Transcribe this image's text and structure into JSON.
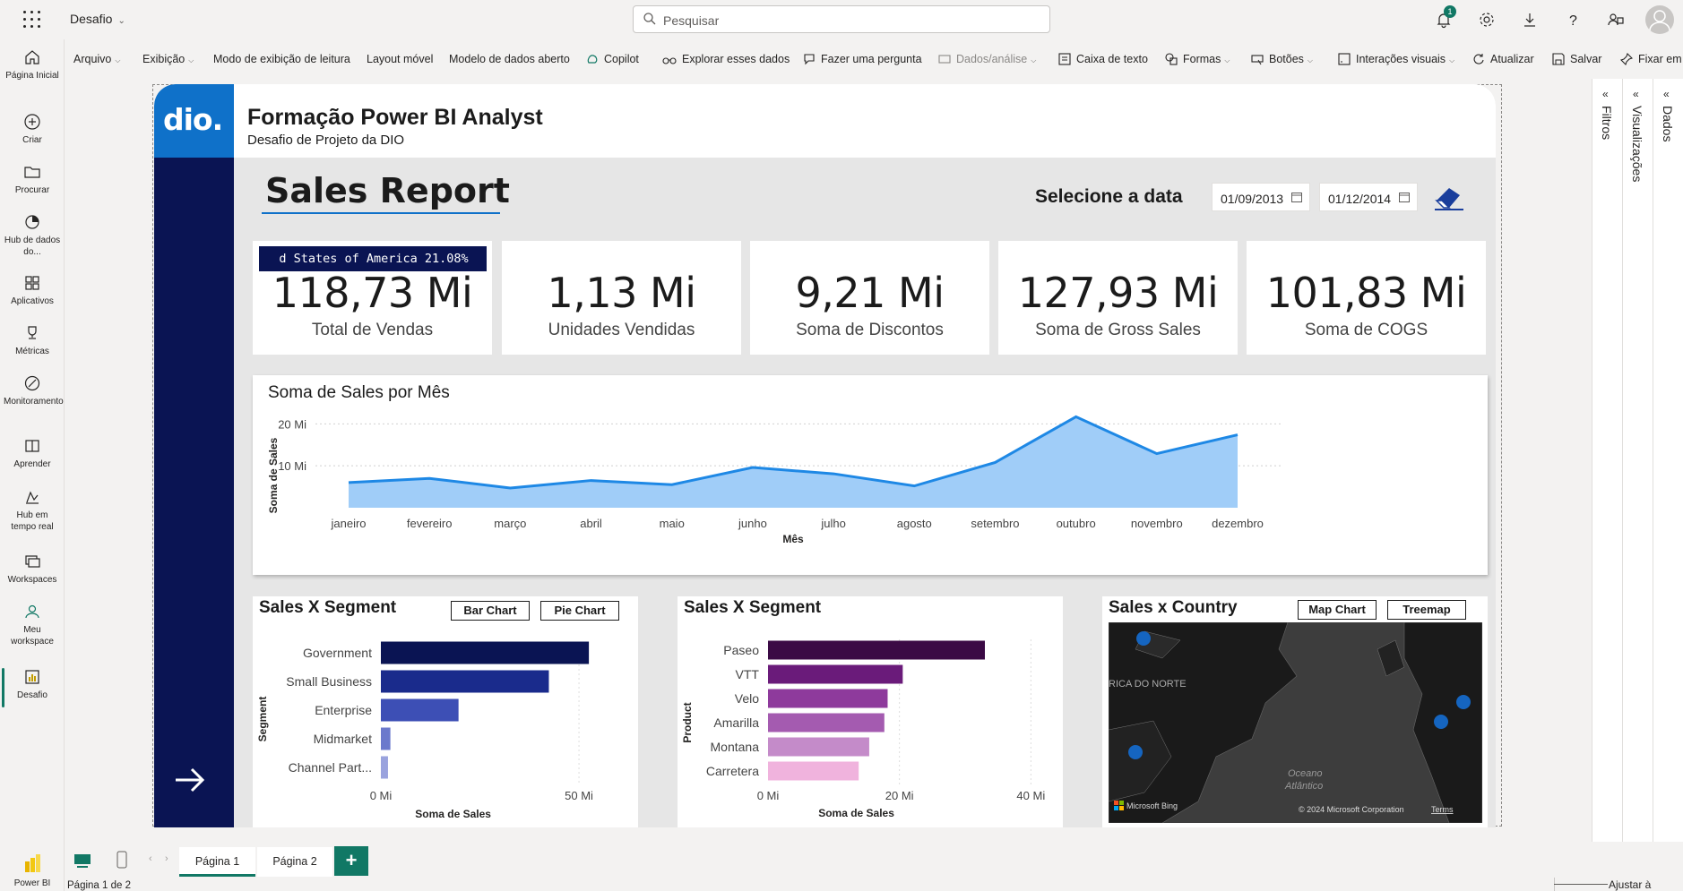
{
  "app": {
    "workspace_title": "Desafio",
    "notification_count": "1"
  },
  "search": {
    "placeholder": "Pesquisar"
  },
  "leftnav": {
    "items": [
      {
        "label": "Página Inicial"
      },
      {
        "label": "Criar"
      },
      {
        "label": "Procurar"
      },
      {
        "label": "Hub de dados do..."
      },
      {
        "label": "Aplicativos"
      },
      {
        "label": "Métricas"
      },
      {
        "label": "Monitoramento"
      },
      {
        "label": "Aprender"
      },
      {
        "label": "Hub em tempo real"
      },
      {
        "label": "Workspaces"
      },
      {
        "label": "Meu workspace"
      },
      {
        "label": "Desafio"
      }
    ],
    "product_label": "Power BI"
  },
  "ribbon": {
    "arquivo": "Arquivo",
    "exibicao": "Exibição",
    "leitura": "Modo de exibição de leitura",
    "layout_movel": "Layout móvel",
    "modelo": "Modelo de dados aberto",
    "copilot": "Copilot",
    "explorar": "Explorar esses dados",
    "pergunta": "Fazer uma pergunta",
    "dados_analise": "Dados/análise",
    "caixa_texto": "Caixa de texto",
    "formas": "Formas",
    "botoes": "Botões",
    "interacoes": "Interações visuais",
    "atualizar": "Atualizar",
    "salvar": "Salvar",
    "fixar": "Fixar em"
  },
  "report": {
    "header_title": "Formação Power BI Analyst",
    "header_subtitle": "Desafio de Projeto da DIO",
    "logo_text": "dio.",
    "page_title": "Sales Report",
    "date_label": "Selecione a data",
    "date_start": "01/09/2013",
    "date_end": "01/12/2014",
    "tooltip": "d States of America 21.08%",
    "kpis": [
      {
        "value": "118,73 Mi",
        "label": "Total de Vendas"
      },
      {
        "value": "1,13 Mi",
        "label": "Unidades Vendidas"
      },
      {
        "value": "9,21 Mi",
        "label": "Soma de Discontos"
      },
      {
        "value": "127,93 Mi",
        "label": "Soma de Gross Sales"
      },
      {
        "value": "101,83 Mi",
        "label": "Soma de COGS"
      }
    ],
    "segment_card": {
      "title": "Sales X Segment",
      "btn_bar": "Bar Chart",
      "btn_pie": "Pie Chart"
    },
    "product_card": {
      "title": "Sales X Segment"
    },
    "country_card": {
      "title": "Sales x Country",
      "btn_map": "Map Chart",
      "btn_treemap": "Treemap",
      "map_region": "RICA DO NORTE",
      "map_ocean_1": "Oceano",
      "map_ocean_2": "Atlântico",
      "bing": "Microsoft Bing",
      "copyright": "© 2024 Microsoft Corporation",
      "terms": "Terms"
    }
  },
  "panes": {
    "filtros": "Filtros",
    "visualizacoes": "Visualizações",
    "dados": "Dados"
  },
  "tabs": {
    "page1": "Página 1",
    "page2": "Página 2"
  },
  "status": {
    "page_info": "Página 1 de 2",
    "fit": "Ajustar à página"
  },
  "colors": {
    "accent": "#117865",
    "navy": "#0a1453",
    "brand_blue": "#0f71c9",
    "area_fill": "#a0cdf8",
    "line": "#1e88e5"
  },
  "chart_data": [
    {
      "type": "area",
      "title": "Soma de Sales por Mês",
      "xlabel": "Mês",
      "ylabel": "Soma de Sales",
      "categories": [
        "janeiro",
        "fevereiro",
        "março",
        "abril",
        "maio",
        "junho",
        "julho",
        "agosto",
        "setembro",
        "outubro",
        "novembro",
        "dezembro"
      ],
      "values": [
        6.0,
        7.0,
        4.7,
        6.5,
        5.5,
        9.6,
        8.1,
        5.2,
        10.8,
        21.7,
        12.9,
        17.4
      ],
      "yticks": [
        {
          "v": 10,
          "label": "10 Mi"
        },
        {
          "v": 20,
          "label": "20 Mi"
        }
      ],
      "ylim": [
        0,
        22
      ],
      "grid": true
    },
    {
      "type": "bar",
      "orientation": "horizontal",
      "title": "Sales X Segment",
      "ylabel": "Segment",
      "xlabel": "Soma de Sales",
      "categories": [
        "Government",
        "Small Business",
        "Enterprise",
        "Midmarket",
        "Channel Part..."
      ],
      "values": [
        52.5,
        42.4,
        19.6,
        2.4,
        1.8
      ],
      "colors": [
        "#0a1453",
        "#1a2b8c",
        "#3d4fb5",
        "#6b79cc",
        "#9aa3de"
      ],
      "xticks": [
        {
          "v": 0,
          "label": "0 Mi"
        },
        {
          "v": 50,
          "label": "50 Mi"
        }
      ],
      "xlim": [
        0,
        57
      ]
    },
    {
      "type": "bar",
      "orientation": "horizontal",
      "title": "Sales X Segment",
      "ylabel": "Product",
      "xlabel": "Soma de Sales",
      "categories": [
        "Paseo",
        "VTT",
        "Velo",
        "Amarilla",
        "Montana",
        "Carretera"
      ],
      "values": [
        33.0,
        20.5,
        18.2,
        17.7,
        15.4,
        13.8
      ],
      "colors": [
        "#3b0a45",
        "#6a1b7a",
        "#8e3a9c",
        "#a45bb0",
        "#c48bc9",
        "#f0b3dd"
      ],
      "xticks": [
        {
          "v": 0,
          "label": "0 Mi"
        },
        {
          "v": 20,
          "label": "20 Mi"
        },
        {
          "v": 40,
          "label": "40 Mi"
        }
      ],
      "xlim": [
        0,
        42
      ]
    }
  ]
}
